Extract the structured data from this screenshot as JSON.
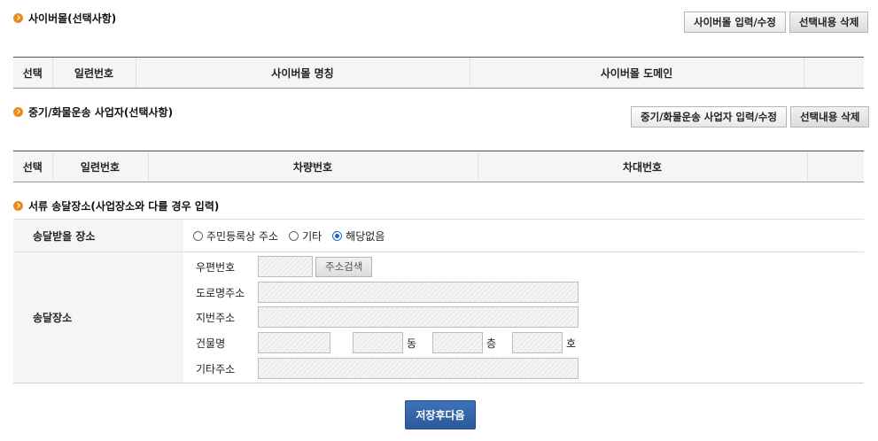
{
  "cyber": {
    "title": "사이버몰(선택사항)",
    "btn_edit": "사이버몰 입력/수정",
    "btn_delete": "선택내용 삭제",
    "headers": [
      "선택",
      "일련번호",
      "사이버몰 명칭",
      "사이버몰 도메인",
      ""
    ]
  },
  "transport": {
    "title": "중기/화물운송 사업자(선택사항)",
    "btn_edit": "중기/화물운송 사업자 입력/수정",
    "btn_delete": "선택내용 삭제",
    "headers": [
      "선택",
      "일련번호",
      "차량번호",
      "차대번호",
      ""
    ]
  },
  "delivery": {
    "title": "서류 송달장소(사업장소와 다를 경우 입력)",
    "receive_label": "송달받을 장소",
    "options": [
      {
        "label": "주민등록상 주소",
        "selected": false
      },
      {
        "label": "기타",
        "selected": false
      },
      {
        "label": "해당없음",
        "selected": true
      }
    ],
    "place_label": "송달장소",
    "postal_label": "우편번호",
    "postal_value": "",
    "search_button": "주소검색",
    "road_label": "도로명주소",
    "road_value": "",
    "lot_label": "지번주소",
    "lot_value": "",
    "building_label": "건물명",
    "building_value": "",
    "dong_unit": "동",
    "floor_unit": "층",
    "ho_unit": "호",
    "etc_label": "기타주소",
    "etc_value": ""
  },
  "footer": {
    "save_next": "저장후다음"
  },
  "colors": {
    "bullet": "#e98a1a",
    "primary": "#2f62a8",
    "radio_selected": "#1a66d6"
  }
}
